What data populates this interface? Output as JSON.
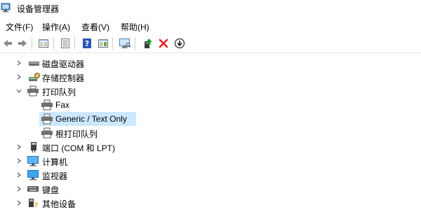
{
  "window": {
    "title": "设备管理器"
  },
  "menu": [
    "文件(F)",
    "操作(A)",
    "查看(V)",
    "帮助(H)"
  ],
  "toolbar": {
    "buttons": [
      "back-icon",
      "forward-icon",
      "properties-pane-icon",
      "device-list-icon",
      "help-icon",
      "action-pane-icon",
      "monitor-scan-icon",
      "update-driver-icon",
      "uninstall-icon",
      "download-icon"
    ]
  },
  "tree": {
    "nodes": [
      {
        "label": "磁盘驱动器",
        "state": "collapsed",
        "icon": "disk-drive-icon"
      },
      {
        "label": "存储控制器",
        "state": "collapsed",
        "icon": "storage-controller-icon"
      },
      {
        "label": "打印队列",
        "state": "expanded",
        "icon": "printer-icon"
      },
      {
        "label": "Fax",
        "state": "leaf",
        "icon": "printer-icon"
      },
      {
        "label": "Generic / Text Only",
        "state": "leaf",
        "icon": "printer-icon",
        "selected": true
      },
      {
        "label": "根打印队列",
        "state": "leaf",
        "icon": "printer-icon"
      },
      {
        "label": "端口 (COM 和 LPT)",
        "state": "collapsed",
        "icon": "port-icon"
      },
      {
        "label": "计算机",
        "state": "collapsed",
        "icon": "computer-icon"
      },
      {
        "label": "监视器",
        "state": "collapsed",
        "icon": "monitor-icon"
      },
      {
        "label": "键盘",
        "state": "collapsed",
        "icon": "keyboard-icon"
      },
      {
        "label": "其他设备",
        "state": "collapsed",
        "icon": "other-device-icon"
      }
    ]
  },
  "colors": {
    "selection": "#cce8ff",
    "accent": "#0078d7"
  }
}
